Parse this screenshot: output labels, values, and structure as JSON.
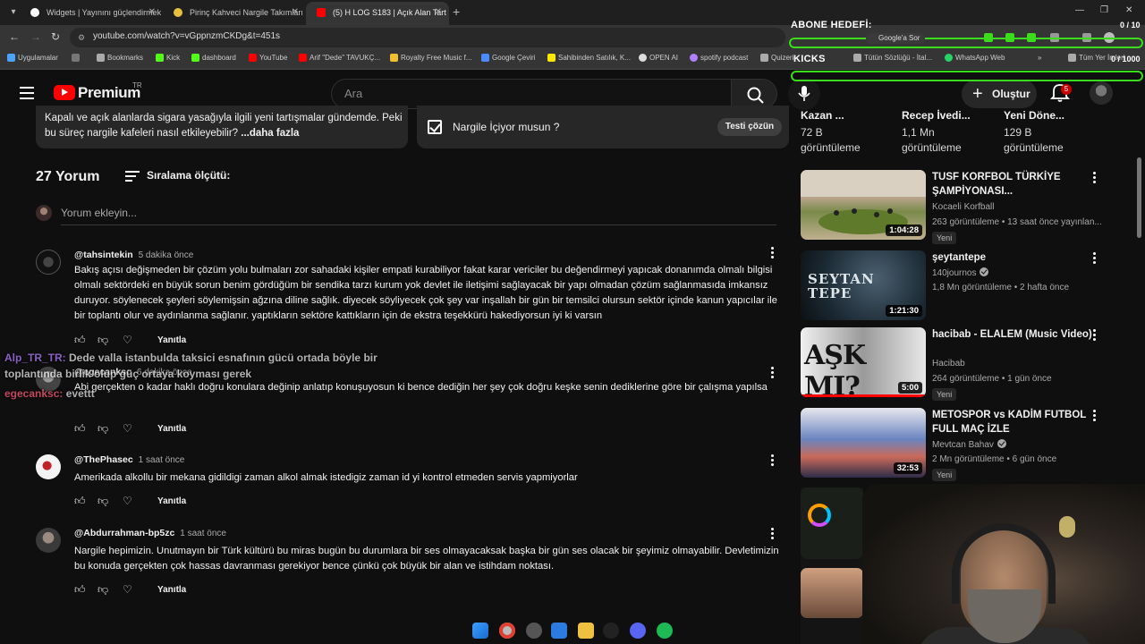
{
  "browser": {
    "tabs": [
      {
        "title": "Widgets | Yayınını güçlendirmek",
        "fav_color": "#ffffff"
      },
      {
        "title": "Pirinç Kahveci Nargile Takımları",
        "fav_color": "#e8c040"
      },
      {
        "title": "(5) H LOG S183 | Açık Alan Tart",
        "fav_color": "#ff0000"
      }
    ],
    "url": "youtube.com/watch?v=vGppnzmCKDg&t=451s",
    "bookmarks": [
      {
        "label": "Uygulamalar",
        "color": "#4aa3ff"
      },
      {
        "label": "Bookmarks",
        "color": "#aaaaaa"
      },
      {
        "label": "Kick",
        "color": "#53fc18"
      },
      {
        "label": "dashboard",
        "color": "#53fc18"
      },
      {
        "label": "YouTube",
        "color": "#ff0000"
      },
      {
        "label": "Arif \"Dede\" TAVUKÇ...",
        "color": "#ff0000"
      },
      {
        "label": "Royalty Free Music f...",
        "color": "#f0c030"
      },
      {
        "label": "Google Çeviri",
        "color": "#4a8cff"
      },
      {
        "label": "Sahibinden Satılık, K...",
        "color": "#ffe800"
      },
      {
        "label": "OPEN AI",
        "color": "#dddddd"
      },
      {
        "label": "spotify podcast",
        "color": "#b080ff"
      },
      {
        "label": "Quizeri",
        "color": "#aaaaaa"
      },
      {
        "label": "Tütün Sözlüğü - İtal...",
        "color": "#aaaaaa"
      },
      {
        "label": "WhatsApp Web",
        "color": "#25d366"
      },
      {
        "label": "Tüm Yer İmleri",
        "color": "#aaaaaa"
      }
    ],
    "google_lens": "Google'a Sor"
  },
  "overlay": {
    "abone_label": "ABONE HEDEFİ:",
    "abone_count": "0 / 10",
    "kicks_label": "KICKS",
    "kicks_count": "0 / 1000",
    "chat": [
      {
        "user": "Alp_TR_TR:",
        "text": "Dede valla istanbulda taksici esnafının gücü ortada böyle bir toplantında birlik olup güç ortaya koyması gerek"
      },
      {
        "user": "egecanksc:",
        "text": "evettt"
      }
    ]
  },
  "youtube": {
    "logo_text": "Premium",
    "logo_region": "TR",
    "search_placeholder": "Ara",
    "create_label": "Oluştur",
    "notif_count": "5"
  },
  "description": {
    "text": "Kapalı ve açık alanlarda sigara yasağıyla ilgili yeni tartışmalar gündemde. Peki bu süreç nargile kafeleri nasıl etkileyebilir?",
    "more": " ...daha fazla"
  },
  "quiz": {
    "question": "Nargile İçiyor musun ?",
    "button": "Testi çözün"
  },
  "comments": {
    "count_label": "27 Yorum",
    "sort_label": "Sıralama ölçütü:",
    "add_placeholder": "Yorum ekleyin...",
    "reply_label": "Yanıtla",
    "items": [
      {
        "author": "@tahsintekin",
        "time": "5 dakika önce",
        "text": "Bakış açısı değişmeden bir çözüm yolu bulmaları zor sahadaki kişiler empati kurabiliyor fakat karar vericiler bu değendirmeyi yapıcak donanımda olmalı bilgisi olmalı sektördeki en büyük sorun benim gördüğüm bir sendika tarzı kurum yok devlet ile iletişimi sağlayacak bir yapı olmadan çözüm sağlanmasıda imkansız duruyor. söylenecek şeyleri söylemişsin ağzına diline sağlık. diyecek söyliyecek çok şey var inşallah bir gün bir temsilci olursun sektör içinde kanun yapıcılar ile bir toplantı olur ve aydınlanma sağlanır. yaptıkların sektöre kattıkların için de ekstra teşekkürü hakediyorsun iyi ki varsın",
        "avatar_color": "#1a1a1a"
      },
      {
        "author": "@egecanksc",
        "time": "6 dakika önce",
        "text": "Abi gerçekten o kadar haklı doğru konulara değinip anlatıp konuşuyosun ki bence dediğin her şey çok doğru keşke senin dediklerine göre bir çalışma yapılsa",
        "avatar_color": "#555555"
      },
      {
        "author": "@ThePhasec",
        "time": "1 saat önce",
        "text": "Amerikada alkollu bir mekana gidildigi zaman alkol almak istedigiz zaman id yi kontrol etmeden servis yapmiyorlar",
        "avatar_color": "#eeeeee"
      },
      {
        "author": "@Abdurrahman-bp5zc",
        "time": "1 saat önce",
        "text": "Nargile hepimizin. Unutmayın bir Türk kültürü bu miras bugün bu durumlara bir ses olmayacaksak başka bir gün ses olacak bir şeyimiz olmayabilir. Devletimizin bu konuda gerçekten çok hassas davranması gerekiyor bence çünkü çok büyük bir alan ve istihdam noktası.",
        "avatar_color": "#6a6a6a"
      }
    ]
  },
  "sidebar": {
    "partial": [
      {
        "title": "Kazan ...",
        "views": "72 B",
        "views_label": "görüntüleme"
      },
      {
        "title": "Recep İvedi...",
        "views": "1,1 Mn",
        "views_label": "görüntüleme"
      },
      {
        "title": "Yeni Döne...",
        "views": "129 B",
        "views_label": "görüntüleme"
      }
    ],
    "videos": [
      {
        "title": "TUSF KORFBOL TÜRKİYE ŞAMPİYONASI...",
        "channel": "Kocaeli Korfball",
        "verified": false,
        "meta": "263 görüntüleme • 13 saat önce yayınlan...",
        "badge": "Yeni",
        "duration": "1:04:28",
        "thumb": "court"
      },
      {
        "title": "şeytantepe",
        "channel": "140journos",
        "verified": true,
        "meta": "1,8 Mn görüntüleme • 2 hafta önce",
        "badge": "",
        "duration": "1:21:30",
        "thumb": "dark",
        "thumb_text": "SEYTAN TEPE"
      },
      {
        "title": "hacibab - ELALEM (Music Video)",
        "channel": "Hacibab",
        "verified": false,
        "meta": "264 görüntüleme • 1 gün önce",
        "badge": "Yeni",
        "duration": "5:00",
        "thumb": "mono",
        "thumb_text": "AŞK MI?"
      },
      {
        "title": "METOSPOR vs KADİM FUTBOL FULL MAÇ İZLE",
        "channel": "Mevtcan Bahav",
        "verified": true,
        "meta": "2 Mn görüntüleme • 6 gün önce",
        "badge": "Yeni",
        "duration": "32:53",
        "thumb": "crowd"
      }
    ]
  }
}
